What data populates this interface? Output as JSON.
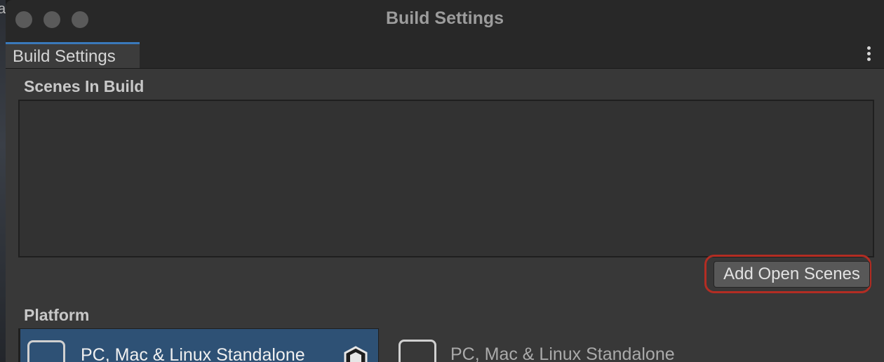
{
  "background_app": {
    "edge_text": "a"
  },
  "window": {
    "title": "Build Settings"
  },
  "tabs": [
    {
      "label": "Build Settings",
      "active": true
    }
  ],
  "scenes_in_build": {
    "label": "Scenes In Build",
    "scenes": []
  },
  "buttons": {
    "add_open_scenes": "Add Open Scenes"
  },
  "platform": {
    "label": "Platform",
    "items": [
      {
        "label": "PC, Mac & Linux Standalone",
        "selected": true,
        "icon": "monitor-icon",
        "badge_icon": "unity-logo-icon"
      },
      {
        "label": "PC, Mac & Linux Standalone",
        "selected": false,
        "icon": "monitor-icon"
      }
    ]
  },
  "colors": {
    "window_bg": "#383838",
    "titlebar_bg": "#282828",
    "tab_accent": "#3a79bb",
    "selected_platform_bg": "#2e5175",
    "highlight_ring": "#b32d23"
  }
}
